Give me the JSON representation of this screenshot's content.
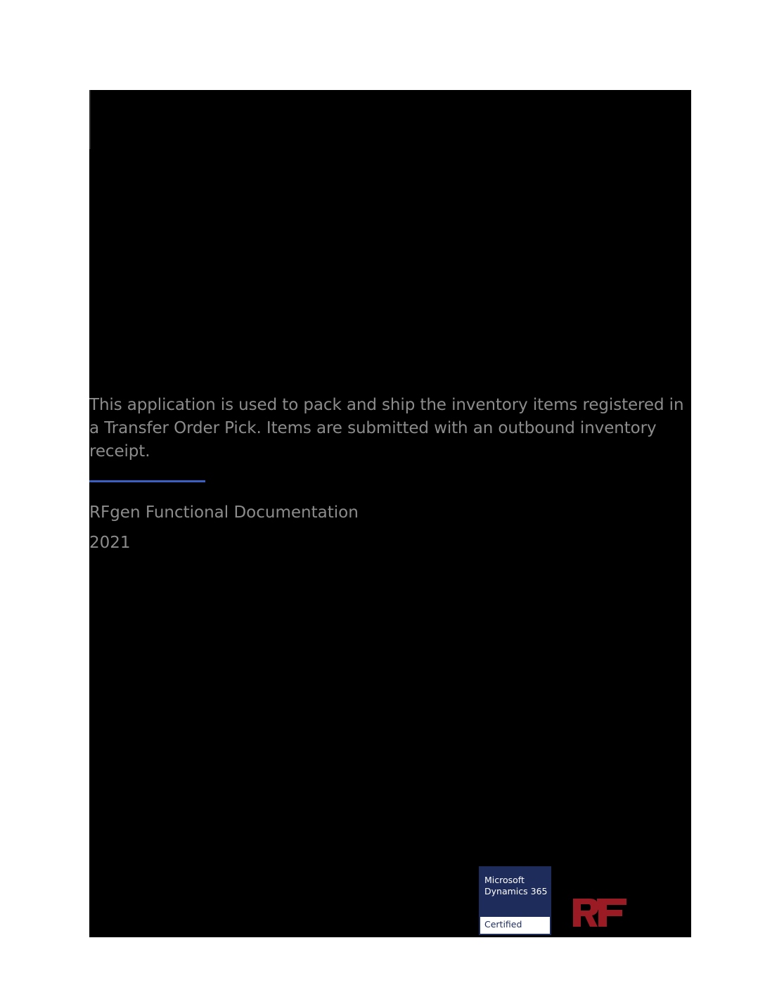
{
  "cover": {
    "description": "This application is used to pack and ship the inventory items registered in a Transfer Order Pick. Items are submitted with an outbound inventory receipt.",
    "series": "RFgen Functional Documentation",
    "year": "2021"
  },
  "badge": {
    "line1": "Microsoft",
    "line2": "Dynamics 365",
    "label": "Certified"
  },
  "colors": {
    "background": "#000000",
    "text": "#8c8c8c",
    "divider": "#3a60c4",
    "badge": "#1e2c5c",
    "logo": "#9b1b24"
  },
  "logo": {
    "icon": "rfgen-logo-icon"
  }
}
